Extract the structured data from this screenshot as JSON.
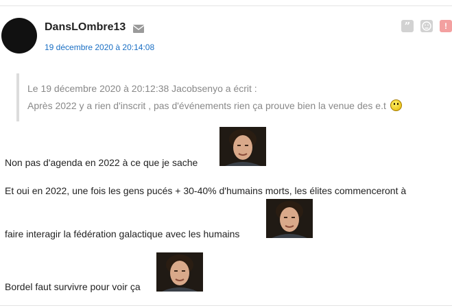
{
  "post": {
    "author": "DansLOmbre13",
    "date": "19 décembre 2020 à 20:14:08",
    "quote": {
      "header": "Le 19 décembre 2020 à 20:12:38 Jacobsenyo a écrit :",
      "text": "Après 2022 y a rien d'inscrit , pas d'événements rien ça prouve bien la venue des e.t"
    },
    "lines": [
      "Non pas d'agenda en 2022 à ce que je sache",
      "Et oui en 2022, une fois les gens pucés + 30-40% d'humains morts, les élites commenceront à",
      "faire interagir la fédération galactique avec les humains",
      "Bordel faut survivre pour voir ça"
    ]
  },
  "icons": {
    "mail": "envelope-icon",
    "quote": "quote-icon",
    "sad": "sad-face-icon",
    "alert": "alert-icon",
    "smiley": "worried-smiley-icon",
    "sticker": "sticker-image"
  },
  "colors": {
    "date_link": "#1a6fc4",
    "quote_text": "#888888",
    "quote_border": "#dcdcdc",
    "alert_button": "#f3a0a0"
  }
}
